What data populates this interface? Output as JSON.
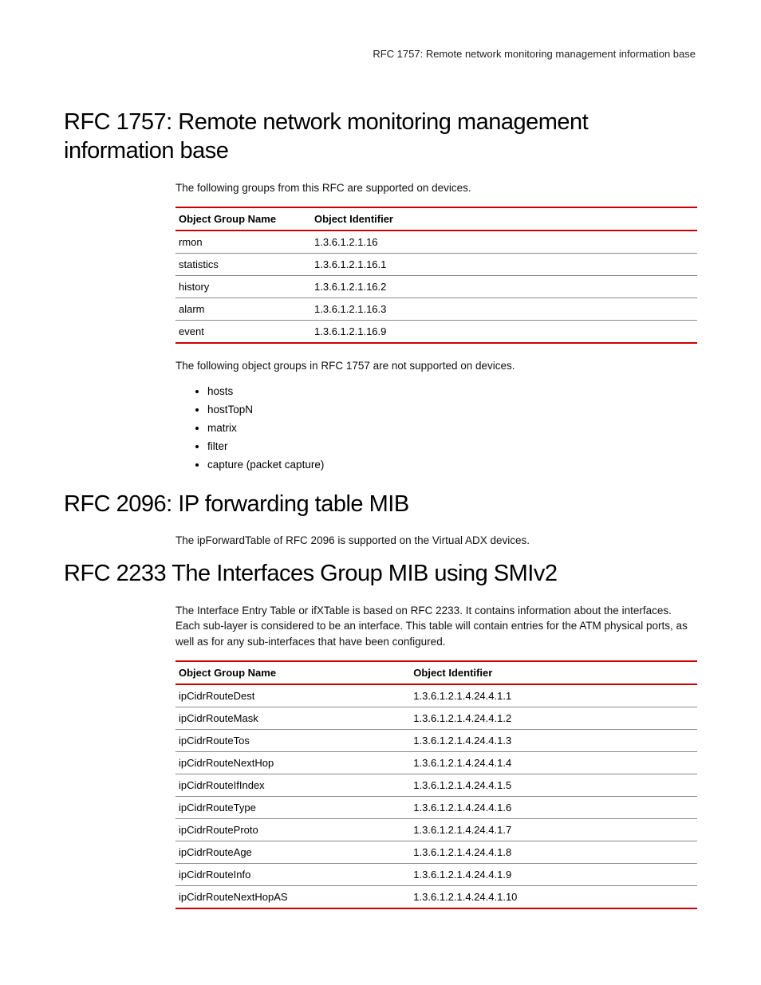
{
  "header": {
    "running_title": "RFC 1757: Remote network monitoring management information base"
  },
  "sections": [
    {
      "heading": "RFC 1757: Remote network monitoring management information base",
      "intro": "The following groups from this RFC are supported on devices.",
      "table": {
        "headers": [
          "Object Group Name",
          "Object Identifier"
        ],
        "rows": [
          [
            "rmon",
            "1.3.6.1.2.1.16"
          ],
          [
            "statistics",
            "1.3.6.1.2.1.16.1"
          ],
          [
            "history",
            "1.3.6.1.2.1.16.2"
          ],
          [
            "alarm",
            "1.3.6.1.2.1.16.3"
          ],
          [
            "event",
            "1.3.6.1.2.1.16.9"
          ]
        ]
      },
      "after": "The following object groups in RFC 1757 are not supported on devices.",
      "bullets": [
        "hosts",
        "hostTopN",
        "matrix",
        "filter",
        "capture (packet capture)"
      ]
    },
    {
      "heading": "RFC 2096: IP forwarding table MIB",
      "intro": "The ipForwardTable of RFC 2096 is supported on the Virtual ADX devices."
    },
    {
      "heading": "RFC 2233 The Interfaces Group MIB using SMIv2",
      "intro": "The Interface Entry Table or ifXTable is based on RFC 2233. It contains information about the interfaces. Each sub-layer is considered to be an interface. This table will contain entries for the ATM physical ports, as well as for any sub-interfaces that have been configured.",
      "table": {
        "headers": [
          "Object Group Name",
          "Object Identifier"
        ],
        "rows": [
          [
            "ipCidrRouteDest",
            "1.3.6.1.2.1.4.24.4.1.1"
          ],
          [
            "ipCidrRouteMask",
            "1.3.6.1.2.1.4.24.4.1.2"
          ],
          [
            "ipCidrRouteTos",
            "1.3.6.1.2.1.4.24.4.1.3"
          ],
          [
            "ipCidrRouteNextHop",
            "1.3.6.1.2.1.4.24.4.1.4"
          ],
          [
            "ipCidrRouteIfIndex",
            "1.3.6.1.2.1.4.24.4.1.5"
          ],
          [
            "ipCidrRouteType",
            "1.3.6.1.2.1.4.24.4.1.6"
          ],
          [
            "ipCidrRouteProto",
            "1.3.6.1.2.1.4.24.4.1.7"
          ],
          [
            "ipCidrRouteAge",
            "1.3.6.1.2.1.4.24.4.1.8"
          ],
          [
            "ipCidrRouteInfo",
            "1.3.6.1.2.1.4.24.4.1.9"
          ],
          [
            "ipCidrRouteNextHopAS",
            "1.3.6.1.2.1.4.24.4.1.10"
          ]
        ]
      }
    }
  ]
}
